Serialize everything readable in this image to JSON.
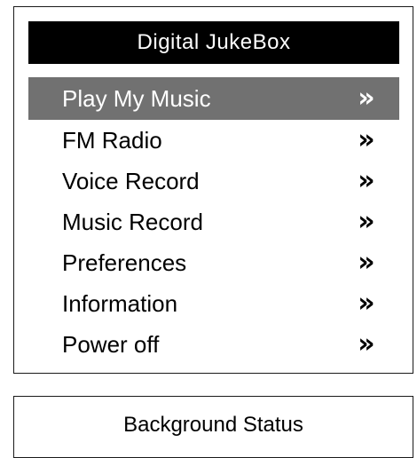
{
  "app": {
    "title": "Digital JukeBox"
  },
  "menu": {
    "selected_index": 0,
    "chevron_icon": "double-chevron-right-icon",
    "items": [
      {
        "label": "Play My Music",
        "chevron": "»"
      },
      {
        "label": "FM Radio",
        "chevron": "»"
      },
      {
        "label": "Voice Record",
        "chevron": "»"
      },
      {
        "label": "Music Record",
        "chevron": "»"
      },
      {
        "label": "Preferences",
        "chevron": "»"
      },
      {
        "label": "Information",
        "chevron": "»"
      },
      {
        "label": "Power off",
        "chevron": "»"
      }
    ]
  },
  "status": {
    "title": "Background Status"
  },
  "colors": {
    "title_bar_bg": "#000000",
    "title_bar_text": "#ffffff",
    "selected_bg": "#717171",
    "selected_text": "#ffffff",
    "border": "#1a1a1a"
  }
}
